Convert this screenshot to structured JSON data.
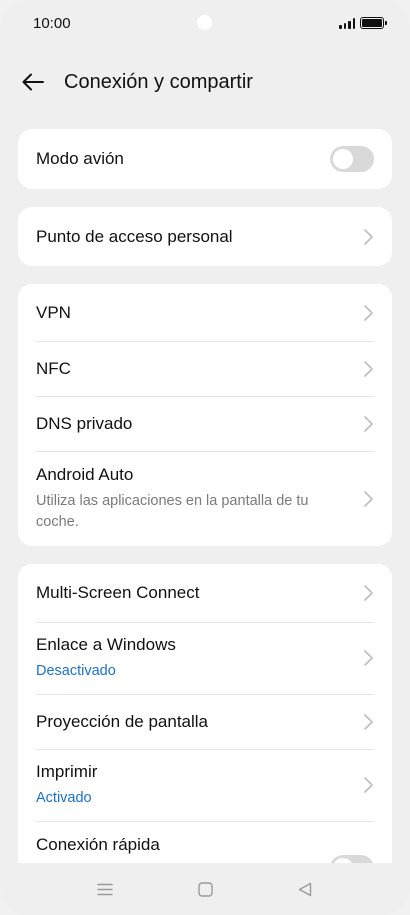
{
  "status_bar": {
    "time": "10:00"
  },
  "header": {
    "title": "Conexión y compartir"
  },
  "groups": [
    {
      "items": [
        {
          "title": "Modo avión",
          "type": "toggle",
          "toggle_on": false
        }
      ]
    },
    {
      "items": [
        {
          "title": "Punto de acceso personal",
          "type": "link"
        }
      ]
    },
    {
      "items": [
        {
          "title": "VPN",
          "type": "link"
        },
        {
          "title": "NFC",
          "type": "link"
        },
        {
          "title": "DNS privado",
          "type": "link"
        },
        {
          "title": "Android Auto",
          "subtitle": "Utiliza las aplicaciones en la pantalla de tu coche.",
          "type": "link"
        }
      ]
    },
    {
      "items": [
        {
          "title": "Multi-Screen Connect",
          "type": "link"
        },
        {
          "title": "Enlace a Windows",
          "subtitle": "Desactivado",
          "type": "link"
        },
        {
          "title": "Proyección de pantalla",
          "type": "link"
        },
        {
          "title": "Imprimir",
          "subtitle": "Activado",
          "type": "link"
        },
        {
          "title": "Conexión rápida",
          "type": "toggle",
          "toggle_on": false
        }
      ]
    }
  ],
  "colors": {
    "accent": "#1a73c9",
    "card": "#ffffff",
    "background": "#efefef",
    "toggle_off": "#d9d9d9"
  },
  "icons": {
    "back": "arrow-left-icon",
    "chevron": "chevron-right-icon",
    "nav_menu": "menu-icon",
    "nav_home": "square-home-icon",
    "nav_back": "triangle-back-icon"
  }
}
